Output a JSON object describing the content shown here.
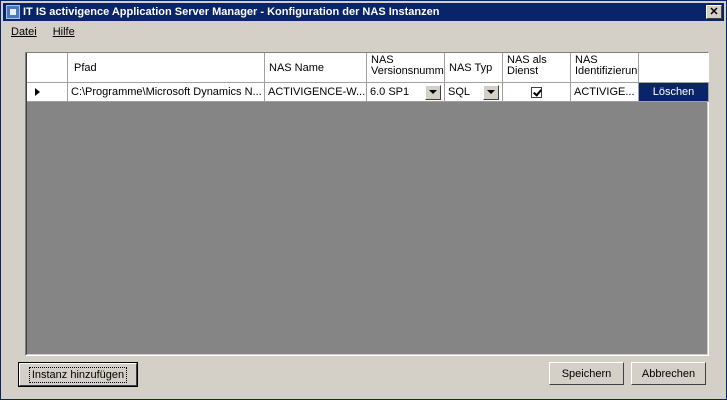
{
  "window": {
    "title": "IT IS activigence Application Server Manager - Konfiguration der NAS Instanzen",
    "close_glyph": "✕"
  },
  "menu": [
    {
      "label": "Datei"
    },
    {
      "label": "Hilfe"
    }
  ],
  "grid": {
    "headers": {
      "pfad": "Pfad",
      "nas_name": "NAS Name",
      "nas_version_1": "NAS",
      "nas_version_2": "Versionsnumm",
      "nas_typ": "NAS Typ",
      "nas_dienst_1": "NAS als",
      "nas_dienst_2": "Dienst",
      "nas_ident_1": "NAS",
      "nas_ident_2": "Identifizierun"
    },
    "rows": [
      {
        "pfad": "C:\\Programme\\Microsoft Dynamics N...",
        "nas_name": "ACTIVIGENCE-W...",
        "version": "6.0 SP1",
        "typ": "SQL",
        "dienst_checked": true,
        "ident": "ACTIVIGE...",
        "delete_label": "Löschen"
      }
    ]
  },
  "buttons": {
    "add_instance": "Instanz hinzufügen",
    "save": "Speichern",
    "cancel": "Abbrechen"
  },
  "colors": {
    "titlebar": "#0a246a",
    "grid_background": "#858585",
    "window_face": "#d4d0c8"
  }
}
